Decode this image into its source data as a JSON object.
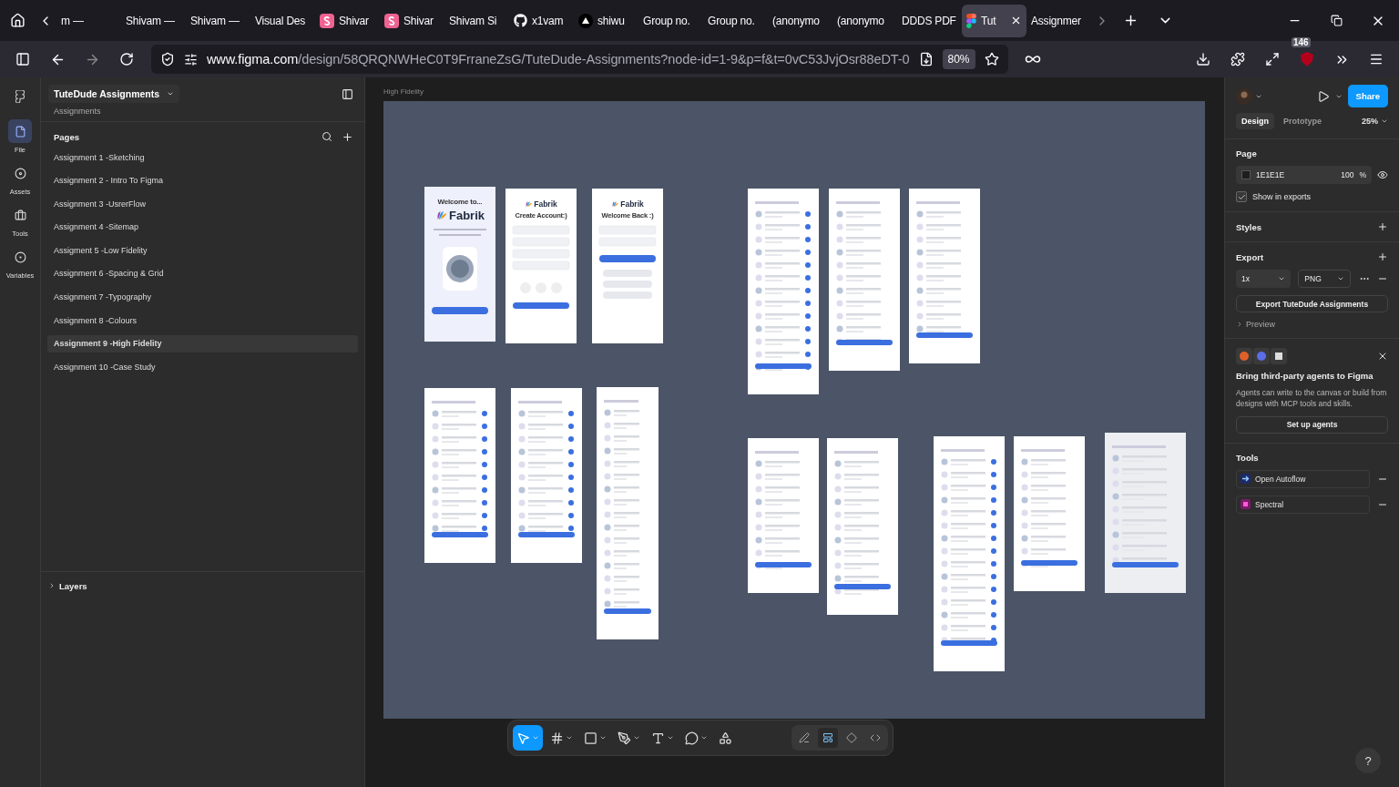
{
  "browser": {
    "tabs": [
      {
        "label": "m —",
        "kind": "plain",
        "selected": false
      },
      {
        "label": "Shivam —",
        "kind": "plain",
        "selected": false
      },
      {
        "label": "Shivam —",
        "kind": "plain",
        "selected": false
      },
      {
        "label": "Visual Des",
        "kind": "plain",
        "selected": false
      },
      {
        "label": "Shivar",
        "kind": "badge",
        "selected": false
      },
      {
        "label": "Shivar",
        "kind": "badge",
        "selected": false
      },
      {
        "label": "Shivam Si",
        "kind": "plain",
        "selected": false
      },
      {
        "label": "x1vam",
        "kind": "github",
        "selected": false
      },
      {
        "label": "shiwu",
        "kind": "triangle",
        "selected": false
      },
      {
        "label": "Group no.",
        "kind": "plain",
        "selected": false
      },
      {
        "label": "Group no.",
        "kind": "plain",
        "selected": false
      },
      {
        "label": "(anonymo",
        "kind": "plain",
        "selected": false
      },
      {
        "label": "(anonymo",
        "kind": "plain",
        "selected": false
      },
      {
        "label": "DDDS PDF",
        "kind": "plain",
        "selected": false
      },
      {
        "label": "Tut",
        "kind": "figma",
        "selected": true
      },
      {
        "label": "Assignmer",
        "kind": "plain",
        "selected": false
      }
    ],
    "url_host": "www.figma.com",
    "url_path": "/design/58QRQNWHeC0T9FrraneZsG/TuteDude-Assignments?node-id=1-9&p=f&t=0vC53JvjOsr88eDT-0",
    "zoom": "80%",
    "extension_badge": "146"
  },
  "rail": [
    {
      "label": "File",
      "kind": "file",
      "selected": true
    },
    {
      "label": "Assets",
      "kind": "assets",
      "selected": false
    },
    {
      "label": "Tools",
      "kind": "tools",
      "selected": false
    },
    {
      "label": "Variables",
      "kind": "variables",
      "selected": false
    }
  ],
  "file": {
    "name": "TuteDude Assignments",
    "project": "Assignments"
  },
  "pages_title": "Pages",
  "pages": [
    {
      "label": "Assignment 1 -Sketching",
      "selected": false
    },
    {
      "label": "Assignment 2 - Intro To Figma",
      "selected": false
    },
    {
      "label": "Assignment 3 -UsrerFlow",
      "selected": false
    },
    {
      "label": "Assignment 4 -Sitemap",
      "selected": false
    },
    {
      "label": "Assigment 5 -Low Fidelity",
      "selected": false
    },
    {
      "label": "Assignment 6 -Spacing & Grid",
      "selected": false
    },
    {
      "label": "Assignment 7 -Typography",
      "selected": false
    },
    {
      "label": "Assignment 8 -Colours",
      "selected": false
    },
    {
      "label": "Assignment 9 -High Fidelity",
      "selected": true
    },
    {
      "label": "Assignment 10 -Case Study",
      "selected": false
    }
  ],
  "layers_title": "Layers",
  "canvas": {
    "frame_label": "High Fidelity",
    "frames": [
      {
        "kind": "welcome",
        "logo": "Fabrik",
        "title": "Welcome to..."
      },
      {
        "kind": "signup",
        "logo": "Fabrik",
        "title": "Create Account:)"
      },
      {
        "kind": "login",
        "logo": "Fabrik",
        "title": "Welcome Back :)"
      },
      {
        "kind": "screen"
      },
      {
        "kind": "screen"
      },
      {
        "kind": "screen"
      },
      {
        "kind": "screen"
      },
      {
        "kind": "screen"
      },
      {
        "kind": "screen"
      },
      {
        "kind": "screen"
      },
      {
        "kind": "screen"
      },
      {
        "kind": "screen"
      },
      {
        "kind": "screen"
      },
      {
        "kind": "screen"
      }
    ]
  },
  "toolbar": {
    "tools": [
      {
        "kind": "move",
        "selected": true
      },
      {
        "kind": "frame",
        "selected": false
      },
      {
        "kind": "rectangle",
        "selected": false
      },
      {
        "kind": "pen",
        "selected": false
      },
      {
        "kind": "text",
        "selected": false
      },
      {
        "kind": "comment",
        "selected": false
      },
      {
        "kind": "actions",
        "selected": false
      }
    ],
    "modes": [
      {
        "kind": "draw",
        "selected": false
      },
      {
        "kind": "design",
        "selected": true
      },
      {
        "kind": "prototype",
        "selected": false
      },
      {
        "kind": "code",
        "selected": false
      }
    ]
  },
  "right": {
    "share": "Share",
    "tabs": [
      {
        "label": "Design",
        "selected": true
      },
      {
        "label": "Prototype",
        "selected": false
      }
    ],
    "zoom": "25%",
    "page_title": "Page",
    "page_color": "1E1E1E",
    "opacity": "100",
    "opacity_unit": "%",
    "show_in_exports": {
      "label": "Show in exports",
      "checked": true
    },
    "styles_title": "Styles",
    "export_title": "Export",
    "scale": "1x",
    "format": "PNG",
    "export_button": "Export TuteDude Assignments",
    "preview": "Preview",
    "promo": {
      "title": "Bring third-party agents to Figma",
      "body": "Agents can write to the canvas or build from designs with MCP tools and skills.",
      "button": "Set up agents"
    },
    "tools_title": "Tools",
    "tools": [
      {
        "label": "Open Autoflow",
        "kind": "autoflow"
      },
      {
        "label": "Spectral",
        "kind": "spectral"
      }
    ]
  },
  "help": "?"
}
